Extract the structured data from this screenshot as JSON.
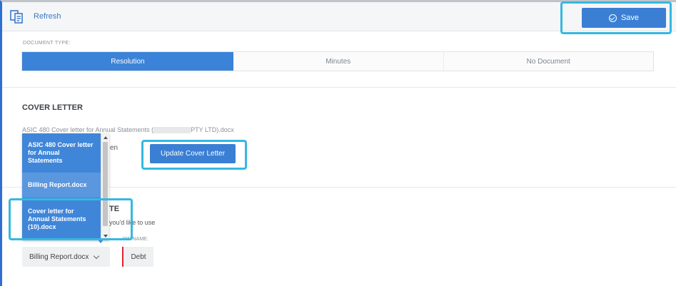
{
  "toolbar": {
    "refresh_label": "Refresh",
    "save_label": "Save",
    "doc_icon": "document-copy-icon",
    "save_icon": "check-circle-icon"
  },
  "document_type": {
    "label": "DOCUMENT TYPE:",
    "options": [
      "Resolution",
      "Minutes",
      "No Document"
    ],
    "selected": "Resolution"
  },
  "cover_letter": {
    "title": "COVER LETTER",
    "file_prefix": "ASIC 480 Cover letter for Annual Statements (",
    "file_suffix": "PTY LTD).docx",
    "tail_text": "en",
    "update_button": "Update Cover Letter"
  },
  "template_section": {
    "title_tail": "TE",
    "desc_tail": "you'd like to use",
    "pin_label_tail": "PIN NAME:",
    "selected_file": "Billing Report.docx",
    "pin_value": "Debt"
  },
  "dropdown": {
    "items": [
      "ASIC 480 Cover letter for Annual Statements",
      "Billing Report.docx",
      "Cover letter for Annual Statements (10).docx"
    ]
  },
  "colors": {
    "accent": "#3a7fd4",
    "highlight": "#35b8e2",
    "required": "#e3232e"
  }
}
